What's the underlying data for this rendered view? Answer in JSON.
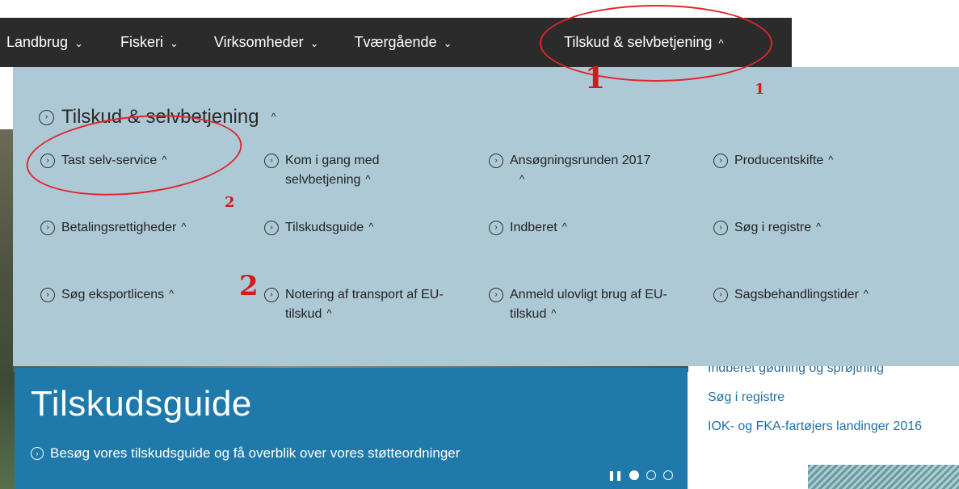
{
  "nav": {
    "items": [
      {
        "label": "Landbrug",
        "chevron": "chevron-down"
      },
      {
        "label": "Fiskeri",
        "chevron": "chevron-down"
      },
      {
        "label": "Virksomheder",
        "chevron": "chevron-down"
      },
      {
        "label": "Tværgående",
        "chevron": "chevron-down"
      },
      {
        "label": "Tilskud & selvbetjening",
        "chevron": "chevron-up"
      }
    ]
  },
  "dropdown": {
    "title": "Tilskud & selvbetjening",
    "items": [
      {
        "label": "Tast selv-service"
      },
      {
        "label": "Kom i gang med selvbetjening"
      },
      {
        "label": "Ansøgningsrunden 2017"
      },
      {
        "label": "Producentskifte"
      },
      {
        "label": "Betalingsrettigheder"
      },
      {
        "label": "Tilskudsguide"
      },
      {
        "label": "Indberet"
      },
      {
        "label": "Søg i registre"
      },
      {
        "label": "Søg eksportlicens"
      },
      {
        "label": "Notering af transport af EU-tilskud"
      },
      {
        "label": "Anmeld ulovligt brug af EU-tilskud"
      },
      {
        "label": "Sagsbehandlingstider"
      }
    ]
  },
  "hero": {
    "title": "Tilskudsguide",
    "subtitle": "Besøg vores tilskudsguide og få overblik over vores støtteordninger"
  },
  "side_links": [
    "Indberet gødning og sprøjtning",
    "Søg i registre",
    "IOK- og FKA-fartøjers landinger 2016"
  ],
  "annotations": {
    "big_1": "1",
    "small_1": "1",
    "small_2": "2",
    "big_2": "2"
  },
  "colors": {
    "nav_bg": "#2b2b2b",
    "dropdown_bg": "#aec9d6",
    "hero_bg": "#1f7aab",
    "link": "#1f6fa5",
    "annotation": "#e0262a"
  }
}
